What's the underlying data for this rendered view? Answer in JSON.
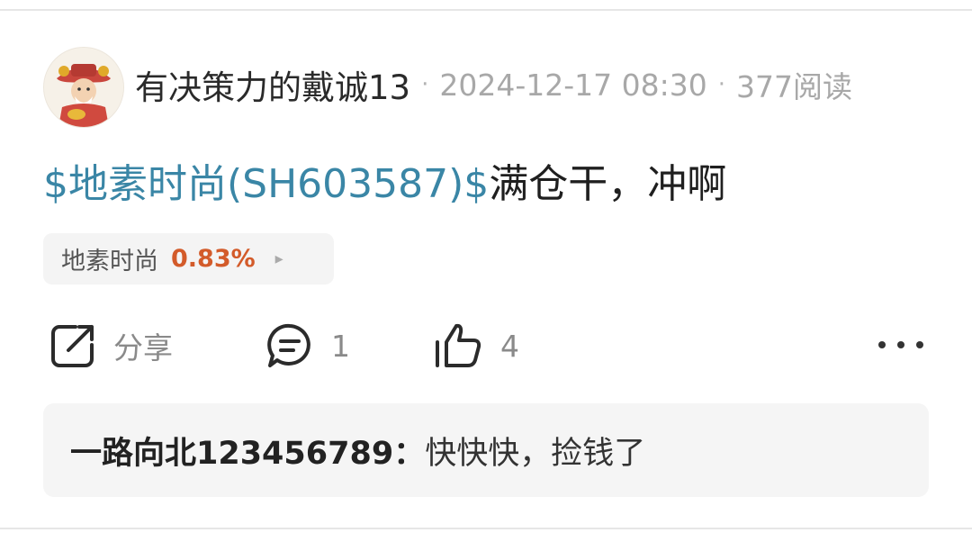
{
  "post": {
    "author": "有决策力的戴诚13",
    "separator": "·",
    "timestamp": "2024-12-17 08:30",
    "reads": "377阅读",
    "stock_link": "$地素时尚(SH603587)$",
    "body": "满仓干，冲啊"
  },
  "stock_chip": {
    "name": "地素时尚",
    "change": "0.83%",
    "arrow": "▸",
    "change_color": "#d35b2a"
  },
  "actions": {
    "share_label": "分享",
    "comment_count": "1",
    "like_count": "4",
    "share_icon": "share-icon",
    "comment_icon": "comment-icon",
    "like_icon": "thumbs-up-icon",
    "more_icon": "more-icon"
  },
  "reply": {
    "user": "一路向北123456789：",
    "text": "快快快，捡钱了"
  },
  "colors": {
    "link": "#3a86a6",
    "muted": "#a8a8a8",
    "chip_bg": "#f4f4f4",
    "reply_bg": "#f5f5f5"
  }
}
